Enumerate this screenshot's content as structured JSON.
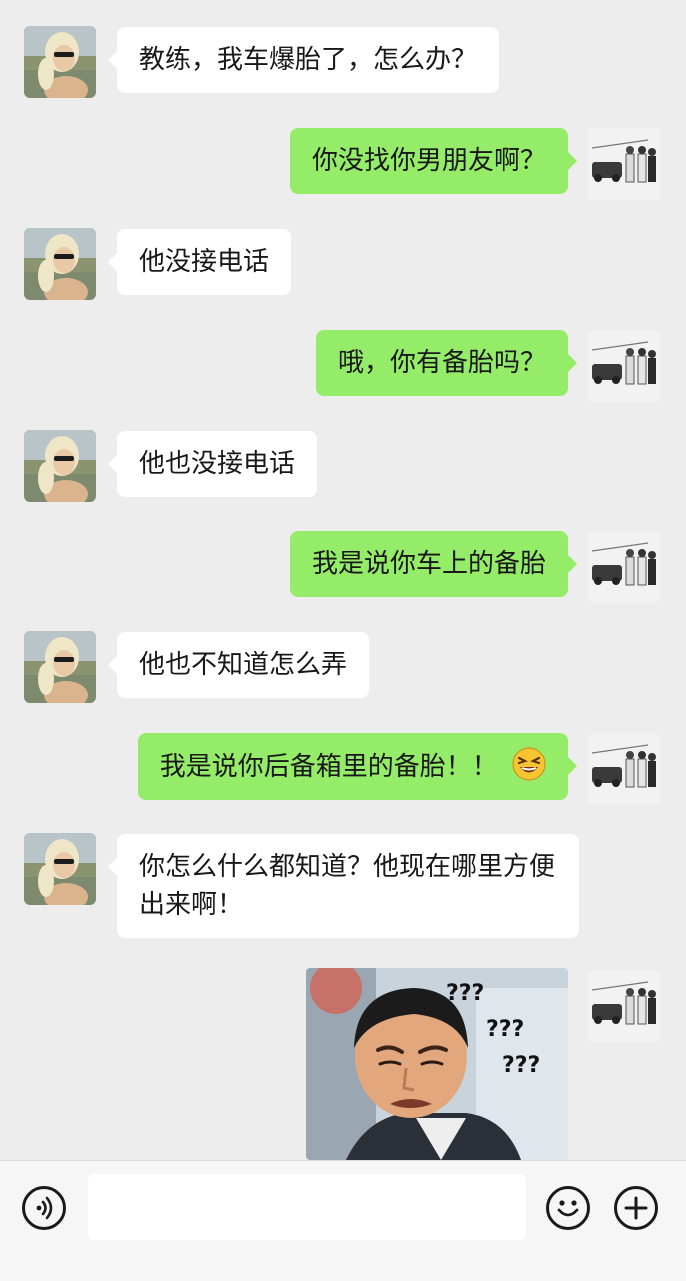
{
  "messages": [
    {
      "side": "in",
      "text": "教练，我车爆胎了，怎么办？"
    },
    {
      "side": "out",
      "text": "你没找你男朋友啊？"
    },
    {
      "side": "in",
      "text": "他没接电话"
    },
    {
      "side": "out",
      "text": "哦，你有备胎吗？"
    },
    {
      "side": "in",
      "text": "他也没接电话"
    },
    {
      "side": "out",
      "text": "我是说你车上的备胎"
    },
    {
      "side": "in",
      "text": "他也不知道怎么弄"
    },
    {
      "side": "out",
      "text": "我是说你后备箱里的备胎！！",
      "emoji": "grinning-squint-face-icon"
    },
    {
      "side": "in",
      "text": "你怎么什么都知道？他现在哪里方便出来啊！"
    },
    {
      "side": "out",
      "type": "sticker",
      "sticker": "confused-man-question-marks",
      "sticker_text": [
        "???",
        "???",
        "???"
      ]
    }
  ],
  "input_bar": {
    "placeholder": "",
    "left_icon": "voice-icon",
    "right_icons": [
      "emoji-icon",
      "plus-icon"
    ]
  },
  "colors": {
    "background": "#ededed",
    "outgoing_bubble": "#95ec69",
    "incoming_bubble": "#ffffff"
  }
}
